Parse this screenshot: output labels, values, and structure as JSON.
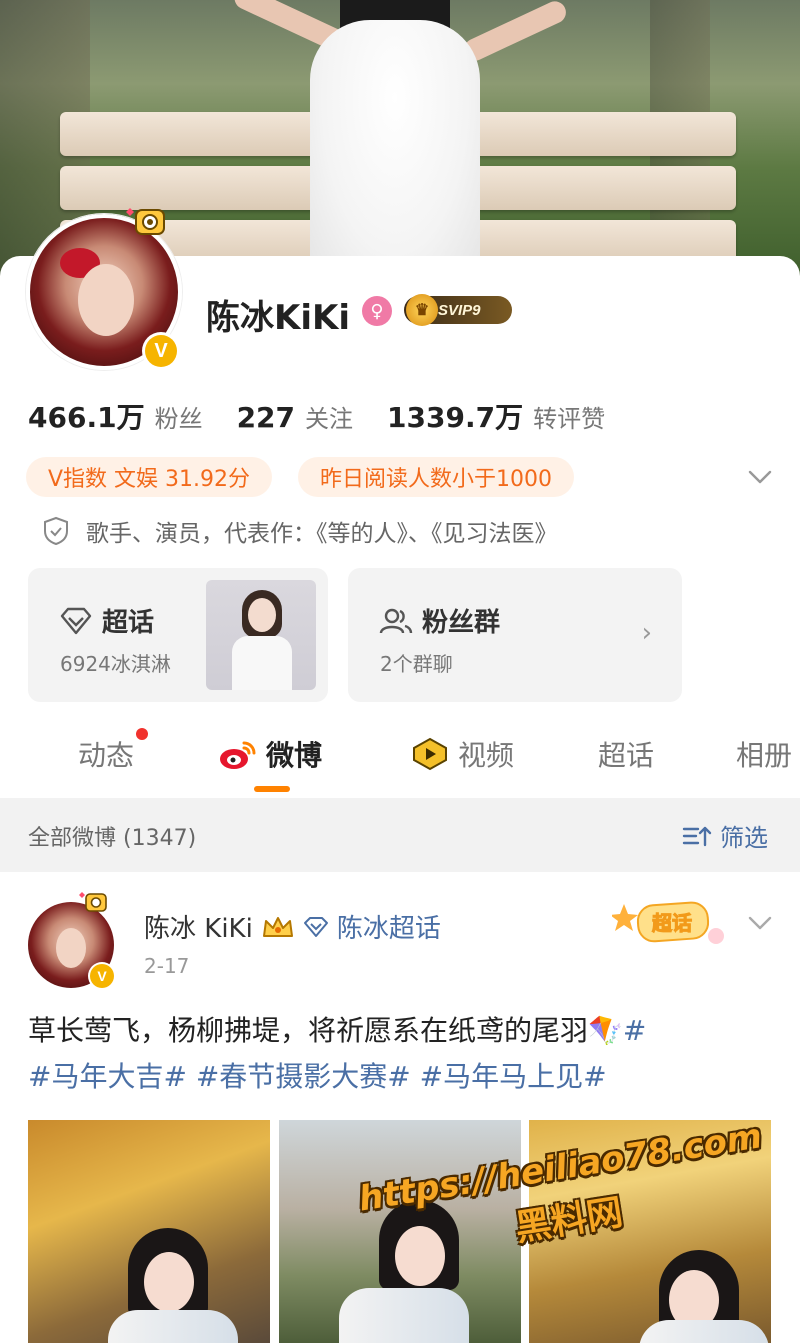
{
  "profile": {
    "name": "陈冰KiKi",
    "gender_symbol": "♀",
    "svip_label": "SVIP9",
    "verified_mark": "V"
  },
  "stats": [
    {
      "value": "466.1万",
      "label": "粉丝"
    },
    {
      "value": "227",
      "label": "关注"
    },
    {
      "value": "1339.7万",
      "label": "转评赞"
    }
  ],
  "tags": {
    "v_index": "V指数 文娱 31.92分",
    "reads": "昨日阅读人数小于1000"
  },
  "bio": "歌手、演员，代表作：《等的人》、《见习法医》",
  "cards": {
    "super_topic": {
      "title": "超话",
      "subtitle": "6924冰淇淋"
    },
    "fan_group": {
      "title": "粉丝群",
      "subtitle": "2个群聊"
    }
  },
  "tabs": [
    {
      "label": "动态"
    },
    {
      "label": "微博"
    },
    {
      "label": "视频"
    },
    {
      "label": "超话"
    },
    {
      "label": "相册"
    }
  ],
  "feed": {
    "all_label": "全部微博 (1347)",
    "filter_label": "筛选"
  },
  "post": {
    "author": "陈冰 KiKi",
    "topic": "陈冰超话",
    "date": "2-17",
    "sticker": "超话",
    "text": "草长莺飞，杨柳拂堤，将祈愿系在纸鸢的尾羽",
    "kite": "🪁",
    "hashtags": "#马年大吉# #春节摄影大赛# #马年马上见#",
    "hash_lead": "#"
  },
  "watermark": {
    "url": "https://heiliao78.com",
    "cn": "黑料网"
  },
  "colors": {
    "accent": "#ff8200",
    "link": "#4a6fa5",
    "tag_text": "#f26a1b",
    "tag_bg": "#fff1e6",
    "verified": "#f6b400"
  }
}
